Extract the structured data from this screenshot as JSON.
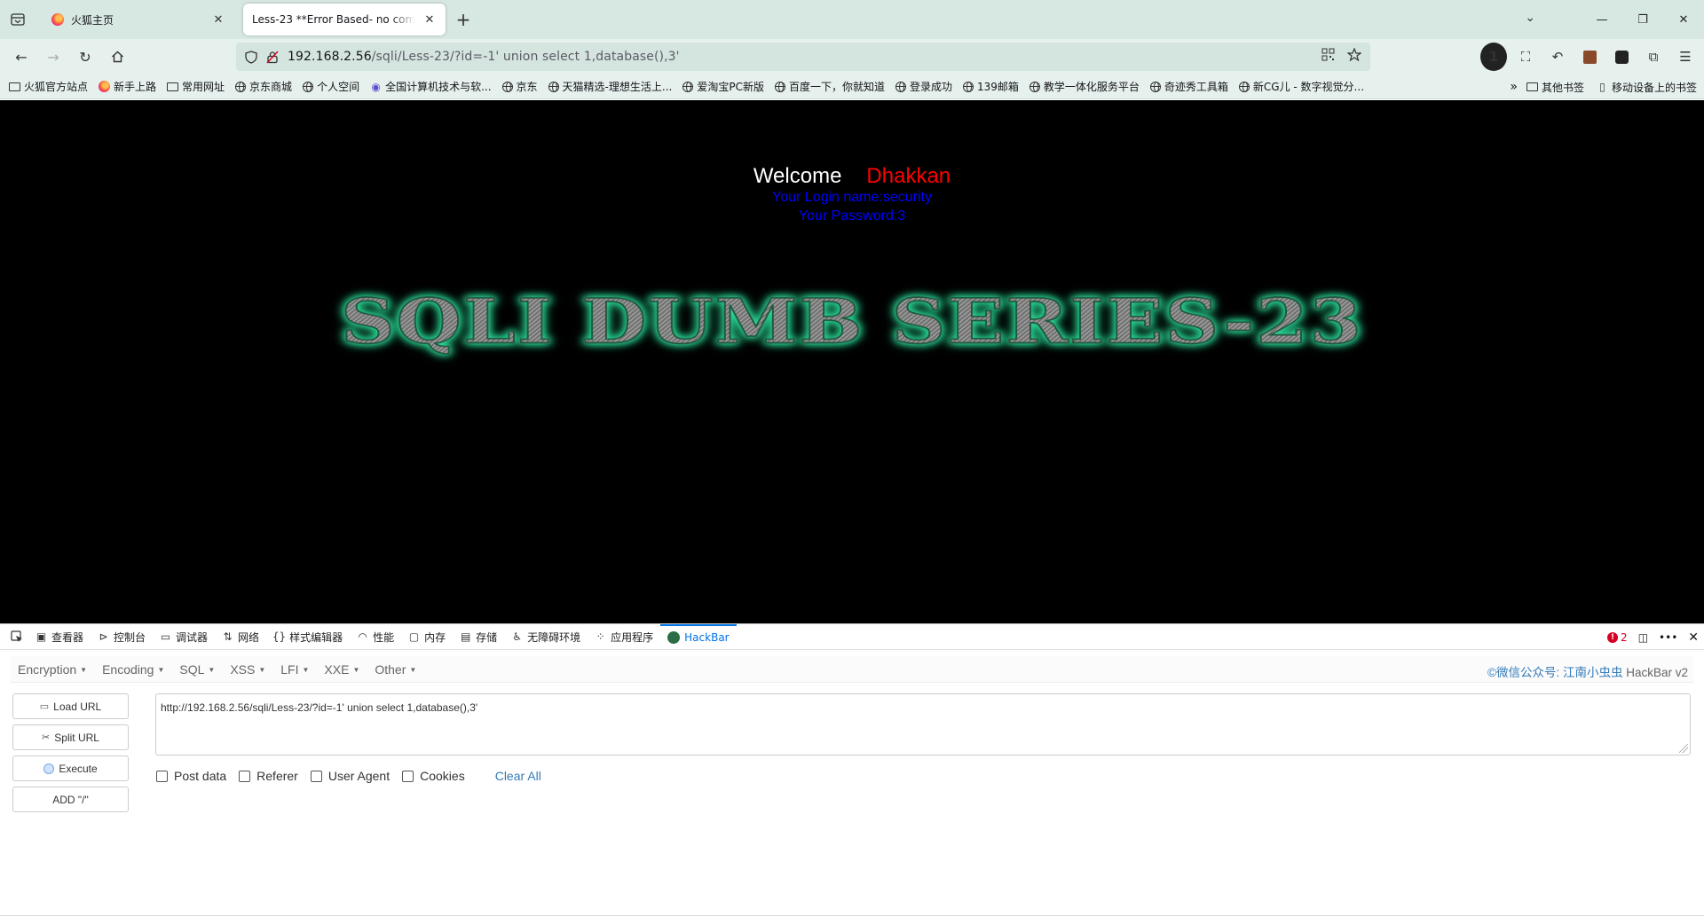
{
  "browser": {
    "tabs": [
      {
        "title": "火狐主页",
        "active": false
      },
      {
        "title": "Less-23 **Error Based- no comm",
        "active": true
      }
    ],
    "url_host": "192.168.2.56",
    "url_rest": "/sqli/Less-23/?id=-1' union select 1,database(),3'",
    "extension_badge": "1"
  },
  "bookmarks": [
    {
      "label": "火狐官方站点",
      "icon": "folder-icon"
    },
    {
      "label": "新手上路",
      "icon": "firefox-icon"
    },
    {
      "label": "常用网址",
      "icon": "folder-icon"
    },
    {
      "label": "京东商城",
      "icon": "globe-icon"
    },
    {
      "label": "个人空间",
      "icon": "globe-icon"
    },
    {
      "label": "全国计算机技术与软...",
      "icon": "site-icon"
    },
    {
      "label": "京东",
      "icon": "globe-icon"
    },
    {
      "label": "天猫精选-理想生活上...",
      "icon": "globe-icon"
    },
    {
      "label": "爱淘宝PC新版",
      "icon": "globe-icon"
    },
    {
      "label": "百度一下，你就知道",
      "icon": "globe-icon"
    },
    {
      "label": "登录成功",
      "icon": "globe-icon"
    },
    {
      "label": "139邮箱",
      "icon": "globe-icon"
    },
    {
      "label": "教学一体化服务平台",
      "icon": "globe-icon"
    },
    {
      "label": "奇迹秀工具箱",
      "icon": "globe-icon"
    },
    {
      "label": "新CG儿 - 数字视觉分...",
      "icon": "globe-icon"
    }
  ],
  "bookmarks_right": {
    "other": "其他书签",
    "mobile": "移动设备上的书签"
  },
  "page": {
    "welcome": "Welcome",
    "user": "Dhakkan",
    "login_name": "Your Login name:security",
    "password": "Your Password:3",
    "banner": "SQLI DUMB SERIES-23"
  },
  "devtools": {
    "tabs": [
      "查看器",
      "控制台",
      "调试器",
      "网络",
      "样式编辑器",
      "性能",
      "内存",
      "存储",
      "无障碍环境",
      "应用程序",
      "HackBar"
    ],
    "active_tab": "HackBar",
    "error_count": "2"
  },
  "hackbar": {
    "menu": [
      "Encryption",
      "Encoding",
      "SQL",
      "XSS",
      "LFI",
      "XXE",
      "Other"
    ],
    "credit_prefix": "©微信公众号: ",
    "credit_name": "江南小虫虫",
    "credit_suffix": " HackBar v2",
    "buttons": {
      "load": "Load URL",
      "split": "Split URL",
      "execute": "Execute",
      "add": "ADD \"/\""
    },
    "url_value": "http://192.168.2.56/sqli/Less-23/?id=-1' union select 1,database(),3'",
    "options": [
      "Post data",
      "Referer",
      "User Agent",
      "Cookies"
    ],
    "clear_all": "Clear All"
  }
}
